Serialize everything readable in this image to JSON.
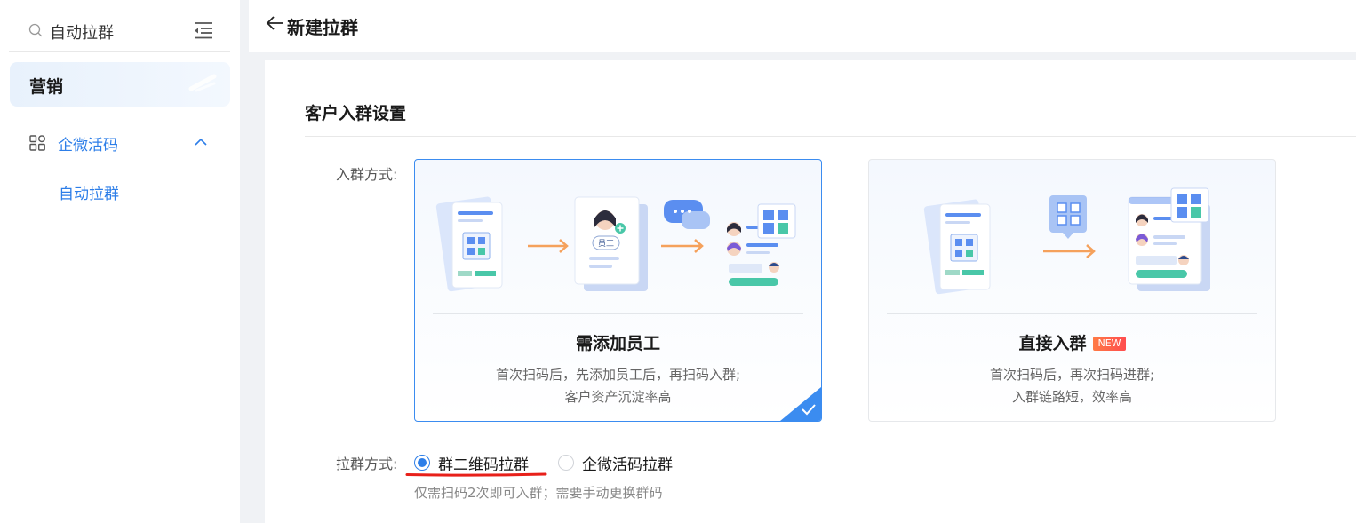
{
  "sidebar": {
    "search_value": "自动拉群",
    "group_label": "营销",
    "item_label": "企微活码",
    "sub_item_label": "自动拉群"
  },
  "header": {
    "title": "新建拉群"
  },
  "main": {
    "section_title": "客户入群设置",
    "join_method_label": "入群方式:",
    "options": [
      {
        "title": "需添加员工",
        "desc_line1": "首次扫码后，先添加员工后，再扫码入群;",
        "desc_line2": "客户资产沉淀率高",
        "illus_badge": "员工",
        "selected": true
      },
      {
        "title": "直接入群",
        "badge": "NEW",
        "desc_line1": "首次扫码后，再次扫码进群;",
        "desc_line2": "入群链路短，效率高",
        "selected": false
      }
    ],
    "pull_method_label": "拉群方式:",
    "pull_options": [
      {
        "label": "群二维码拉群",
        "checked": true
      },
      {
        "label": "企微活码拉群",
        "checked": false
      }
    ],
    "hint": "仅需扫码2次即可入群；需要手动更换群码"
  },
  "colors": {
    "primary": "#2d7ee8",
    "selected_border": "#3b8cf0",
    "annotation_red": "#e8201a",
    "badge_orange": "#ff6a3d"
  }
}
